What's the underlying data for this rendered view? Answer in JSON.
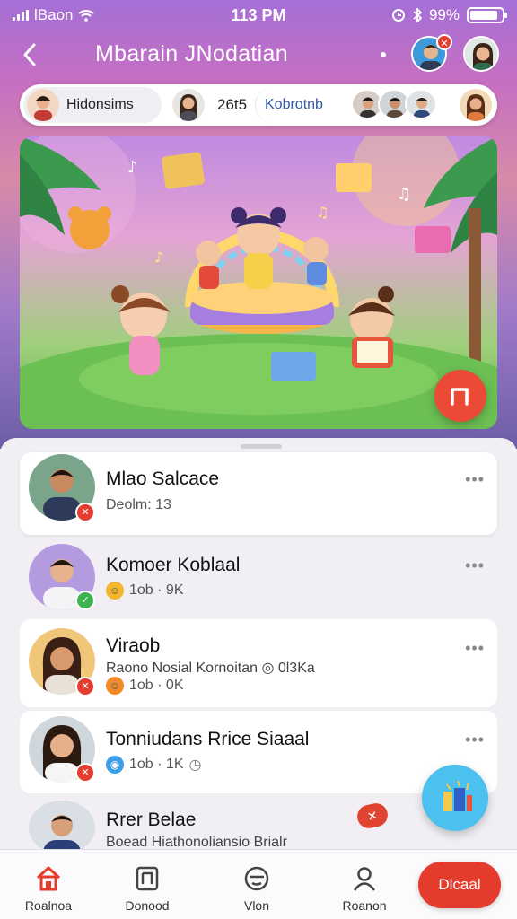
{
  "status_bar": {
    "carrier": "lBaon",
    "time": "113 PM",
    "battery": "99%"
  },
  "header": {
    "title": "Mbarain JNodatian"
  },
  "chips": {
    "chip1_label": "Hidonsims",
    "chip2_value": "26t5",
    "chip3_label": "Kobrotnb"
  },
  "contacts": [
    {
      "name": "Mlao Salcace",
      "meta": "Deolm: 13",
      "badge_color": "#e53d2f"
    },
    {
      "name": "Komoer Koblaal",
      "meta": "1ob · 9K",
      "badge_color": "#3fb34f",
      "emoji_color": "#f5b52c"
    },
    {
      "name": "Viraob",
      "subtitle": "Raono Nosial Kornoitan ◎ 0l3Ka",
      "meta": "1ob · 0K",
      "badge_color": "#e53d2f",
      "emoji_color": "#f08a2a"
    },
    {
      "name": "Tonniudans Rrice Siaaal",
      "meta": "1ob · 1K",
      "badge_color": "#e53d2f",
      "emoji_color": "#3b9ee6"
    },
    {
      "name": "Rrer Belae",
      "subtitle": "Boead Hiathonoliansio Brialr",
      "badge_color": "#e53d2f"
    }
  ],
  "tabs": [
    {
      "label": "Roalnoa"
    },
    {
      "label": "Donood"
    },
    {
      "label": "Vlon"
    },
    {
      "label": "Roanon"
    }
  ],
  "pill_button_label": "Dlcaal",
  "colors": {
    "accent_red": "#e53b2c",
    "accent_blue": "#4cc0ef",
    "link_blue": "#2f5aa8"
  }
}
